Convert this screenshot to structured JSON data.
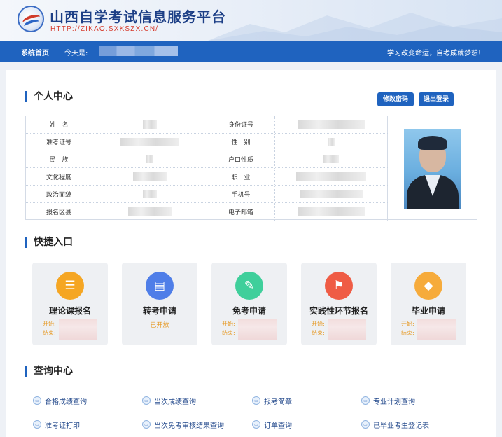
{
  "site": {
    "title": "山西自学考试信息服务平台",
    "url": "HTTP://ZIKAO.SXKSZX.CN/"
  },
  "nav": {
    "home": "系统首页",
    "date_label": "今天是:",
    "slogan": "学习改变命运，自考成就梦想!"
  },
  "personal": {
    "title": "个人中心",
    "change_password": "修改密码",
    "logout": "退出登录",
    "rows": [
      {
        "l1": "姓　名",
        "l2": "身份证号"
      },
      {
        "l1": "准考证号",
        "l2": "性　别"
      },
      {
        "l1": "民　族",
        "l2": "户口性质"
      },
      {
        "l1": "文化程度",
        "l2": "职　业"
      },
      {
        "l1": "政治面貌",
        "l2": "手机号"
      },
      {
        "l1": "报名区县",
        "l2": "电子邮箱"
      }
    ]
  },
  "quick": {
    "title": "快捷入口",
    "start_label": "开始:",
    "end_label": "结束:",
    "cards": [
      {
        "name": "理论课报名",
        "icon": "layers-icon",
        "color": "#f5a623",
        "status": ""
      },
      {
        "name": "转考申请",
        "icon": "document-settings-icon",
        "color": "#4f7ee8",
        "status": "已开放"
      },
      {
        "name": "免考申请",
        "icon": "edit-document-icon",
        "color": "#3fcf9b",
        "status": ""
      },
      {
        "name": "实践性环节报名",
        "icon": "flag-icon",
        "color": "#ef5c45",
        "status": ""
      },
      {
        "name": "毕业申请",
        "icon": "graduation-cap-icon",
        "color": "#f6ab3b",
        "status": ""
      }
    ]
  },
  "query": {
    "title": "查询中心",
    "links": [
      "合格成绩查询",
      "当次成绩查询",
      "报考简章",
      "专业计划查询",
      "准考证打印",
      "当次免考审核结果查询",
      "订单查询",
      "已毕业考生登记表"
    ]
  }
}
